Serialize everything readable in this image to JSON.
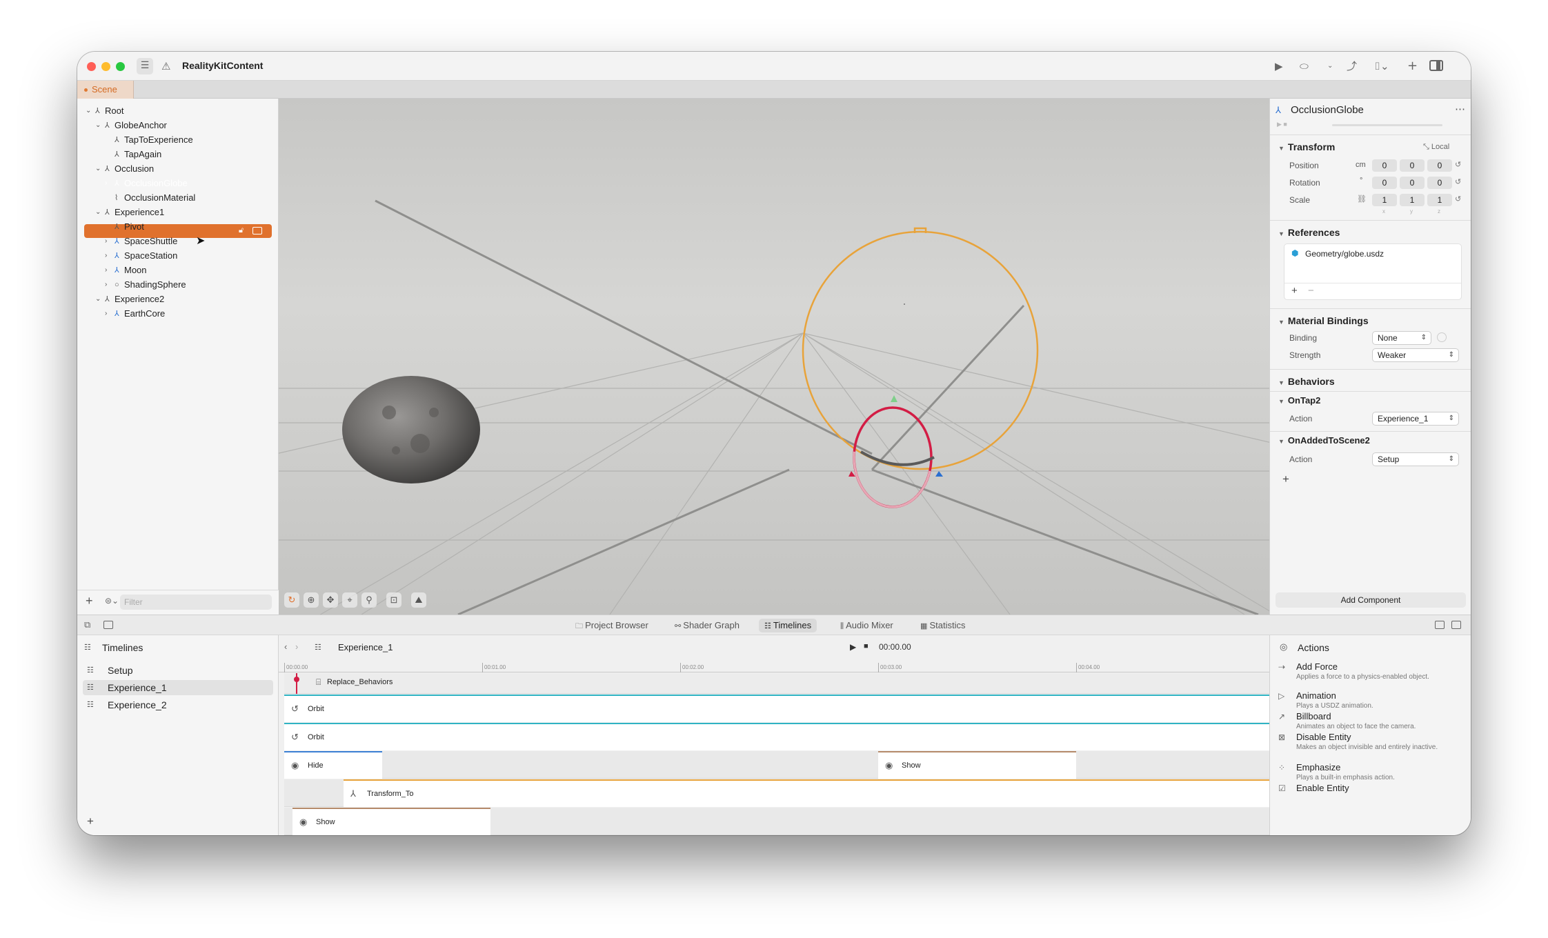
{
  "window": {
    "title": "RealityKitContent",
    "traffic_lights": {
      "close": "#ff5f57",
      "minimize": "#febc2e",
      "zoom": "#28c840"
    }
  },
  "toolbar": {
    "icons": [
      "sidebar-list-icon",
      "warning-icon",
      "play-icon",
      "vision-pro-icon",
      "chevron-down-icon",
      "share-icon",
      "camera-icon",
      "plus-icon",
      "inspector-toggle-icon"
    ]
  },
  "tabs": {
    "scene_label": "Scene"
  },
  "hierarchy": {
    "items": [
      {
        "label": "Root",
        "expand": "open",
        "depth": 0,
        "icon": "entity"
      },
      {
        "label": "GlobeAnchor",
        "expand": "open",
        "depth": 1,
        "icon": "entity"
      },
      {
        "label": "TapToExperience",
        "expand": "none",
        "depth": 2,
        "icon": "entity"
      },
      {
        "label": "TapAgain",
        "expand": "none",
        "depth": 2,
        "icon": "entity"
      },
      {
        "label": "Occlusion",
        "expand": "open",
        "depth": 1,
        "icon": "entity"
      },
      {
        "label": "OcclusionGlobe",
        "expand": "closed",
        "depth": 2,
        "icon": "entity",
        "selected": true
      },
      {
        "label": "OcclusionMaterial",
        "expand": "none",
        "depth": 2,
        "icon": "material"
      },
      {
        "label": "Experience1",
        "expand": "open",
        "depth": 1,
        "icon": "entity"
      },
      {
        "label": "Pivot",
        "expand": "none",
        "depth": 2,
        "icon": "entity"
      },
      {
        "label": "SpaceShuttle",
        "expand": "closed",
        "depth": 2,
        "icon": "model"
      },
      {
        "label": "SpaceStation",
        "expand": "closed",
        "depth": 2,
        "icon": "model"
      },
      {
        "label": "Moon",
        "expand": "closed",
        "depth": 2,
        "icon": "model"
      },
      {
        "label": "ShadingSphere",
        "expand": "closed",
        "depth": 2,
        "icon": "sphere"
      },
      {
        "label": "Experience2",
        "expand": "open",
        "depth": 1,
        "icon": "entity"
      },
      {
        "label": "EarthCore",
        "expand": "closed",
        "depth": 2,
        "icon": "model"
      }
    ],
    "filter_placeholder": "Filter"
  },
  "inspector": {
    "title": "OcclusionGlobe",
    "transform": {
      "header": "Transform",
      "space_label": "Local",
      "position_label": "Position",
      "position_unit": "cm",
      "position": [
        "0",
        "0",
        "0"
      ],
      "rotation_label": "Rotation",
      "rotation_unit": "°",
      "rotation": [
        "0",
        "0",
        "0"
      ],
      "scale_label": "Scale",
      "scale": [
        "1",
        "1",
        "1"
      ],
      "axes": [
        "x",
        "y",
        "z"
      ]
    },
    "references": {
      "header": "References",
      "item": "Geometry/globe.usdz"
    },
    "material_bindings": {
      "header": "Material Bindings",
      "binding_label": "Binding",
      "binding_value": "None",
      "strength_label": "Strength",
      "strength_value": "Weaker"
    },
    "behaviors": {
      "header": "Behaviors",
      "items": [
        {
          "name": "OnTap2",
          "action_label": "Action",
          "action_value": "Experience_1"
        },
        {
          "name": "OnAddedToScene2",
          "action_label": "Action",
          "action_value": "Setup"
        }
      ]
    },
    "add_component_label": "Add Component"
  },
  "bottom_tabs": [
    {
      "label": "Project Browser",
      "icon": "folder-icon",
      "selected": false
    },
    {
      "label": "Shader Graph",
      "icon": "graph-icon",
      "selected": false
    },
    {
      "label": "Timelines",
      "icon": "timeline-icon",
      "selected": true
    },
    {
      "label": "Audio Mixer",
      "icon": "mixer-icon",
      "selected": false
    },
    {
      "label": "Statistics",
      "icon": "stats-icon",
      "selected": false
    }
  ],
  "timelines": {
    "header": "Timelines",
    "items": [
      {
        "label": "Setup",
        "selected": false
      },
      {
        "label": "Experience_1",
        "selected": true
      },
      {
        "label": "Experience_2",
        "selected": false
      }
    ]
  },
  "editor": {
    "timeline_name": "Experience_1",
    "time": "00:00.00",
    "ruler": [
      "00:00.00",
      "00:01.00",
      "00:02.00",
      "00:03.00",
      "00:04.00"
    ],
    "tracks": [
      {
        "clips": [
          {
            "label": "Replace_Behaviors",
            "icon": "behavior-icon"
          }
        ]
      },
      {
        "clips": [
          {
            "label": "Orbit",
            "icon": "orbit-icon"
          }
        ]
      },
      {
        "clips": [
          {
            "label": "Orbit",
            "icon": "orbit-icon"
          }
        ]
      },
      {
        "clips": [
          {
            "label": "Hide",
            "icon": "eye-icon"
          },
          {
            "label": "Show",
            "icon": "eye-icon"
          }
        ]
      },
      {
        "clips": [
          {
            "label": "Transform_To",
            "icon": "transform-icon"
          }
        ]
      },
      {
        "clips": [
          {
            "label": "Show",
            "icon": "eye-icon"
          }
        ]
      }
    ]
  },
  "actions": {
    "header": "Actions",
    "items": [
      {
        "title": "Add Force",
        "desc": "Applies a force to a physics-enabled object.",
        "icon": "force-icon"
      },
      {
        "title": "Animation",
        "desc": "Plays a USDZ animation.",
        "icon": "animation-icon"
      },
      {
        "title": "Billboard",
        "desc": "Animates an object to face the camera.",
        "icon": "billboard-icon"
      },
      {
        "title": "Disable Entity",
        "desc": "Makes an object invisible and entirely inactive.",
        "icon": "disable-icon"
      },
      {
        "title": "Emphasize",
        "desc": "Plays a built-in emphasis action.",
        "icon": "emphasize-icon"
      },
      {
        "title": "Enable Entity",
        "desc": "",
        "icon": "enable-icon"
      }
    ]
  },
  "colors": {
    "accent": "#e0712d",
    "globe_outline": "#e8a33a",
    "orbit_line": "#2fb3c3",
    "hide_bar": "#3b7fd4",
    "transform_bar": "#e8a33a",
    "show_bar": "#b58a6a"
  }
}
